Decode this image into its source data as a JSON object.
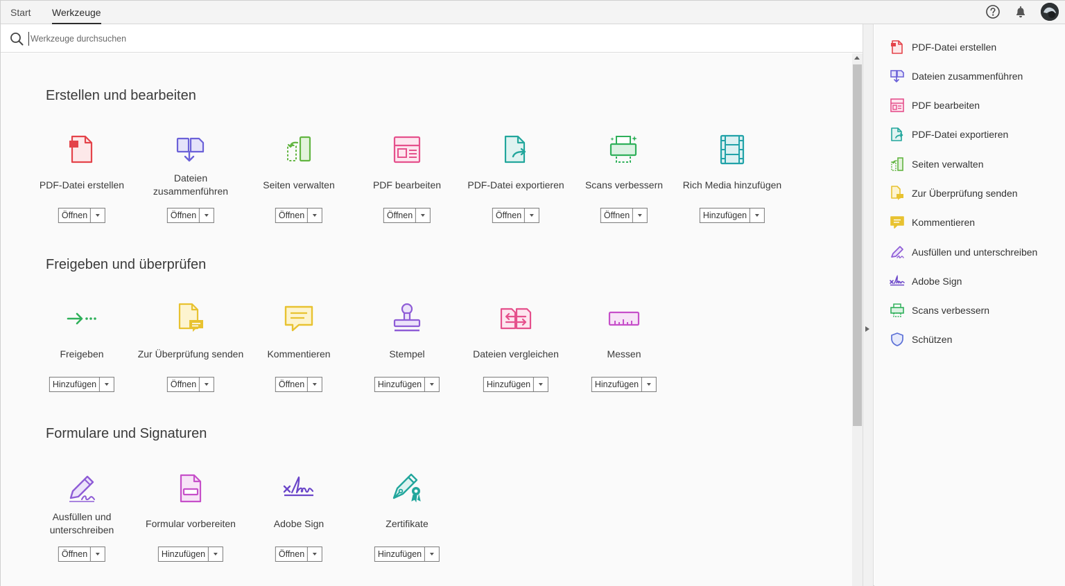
{
  "tabs": {
    "start": "Start",
    "tools": "Werkzeuge"
  },
  "search": {
    "placeholder": "Werkzeuge durchsuchen",
    "value": ""
  },
  "sections": [
    {
      "title": "Erstellen und bearbeiten",
      "tools": [
        {
          "label": "PDF-Datei erstellen",
          "button": "Öffnen",
          "icon": "create-pdf-icon",
          "color": "#e4434a"
        },
        {
          "label": "Dateien zusammenführen",
          "button": "Öffnen",
          "icon": "combine-files-icon",
          "color": "#6b61d8"
        },
        {
          "label": "Seiten verwalten",
          "button": "Öffnen",
          "icon": "organize-pages-icon",
          "color": "#62b541"
        },
        {
          "label": "PDF bearbeiten",
          "button": "Öffnen",
          "icon": "edit-pdf-icon",
          "color": "#e5508c"
        },
        {
          "label": "PDF-Datei exportieren",
          "button": "Öffnen",
          "icon": "export-pdf-icon",
          "color": "#22a69c"
        },
        {
          "label": "Scans verbessern",
          "button": "Öffnen",
          "icon": "enhance-scans-icon",
          "color": "#2fb05a"
        },
        {
          "label": "Rich Media hinzufügen",
          "button": "Hinzufügen",
          "icon": "rich-media-icon",
          "color": "#21a2a8"
        }
      ]
    },
    {
      "title": "Freigeben und überprüfen",
      "tools": [
        {
          "label": "Freigeben",
          "button": "Hinzufügen",
          "icon": "share-icon",
          "color": "#2fb05a"
        },
        {
          "label": "Zur Überprüfung senden",
          "button": "Öffnen",
          "icon": "send-review-icon",
          "color": "#e8c230"
        },
        {
          "label": "Kommentieren",
          "button": "Öffnen",
          "icon": "comment-icon",
          "color": "#e8c230"
        },
        {
          "label": "Stempel",
          "button": "Hinzufügen",
          "icon": "stamp-icon",
          "color": "#8e5cd6"
        },
        {
          "label": "Dateien vergleichen",
          "button": "Hinzufügen",
          "icon": "compare-files-icon",
          "color": "#e5508c"
        },
        {
          "label": "Messen",
          "button": "Hinzufügen",
          "icon": "measure-icon",
          "color": "#c64fc9"
        }
      ]
    },
    {
      "title": "Formulare und Signaturen",
      "tools": [
        {
          "label": "Ausfüllen und unterschreiben",
          "button": "Öffnen",
          "icon": "fill-sign-icon",
          "color": "#8e5cd6"
        },
        {
          "label": "Formular vorbereiten",
          "button": "Hinzufügen",
          "icon": "prepare-form-icon",
          "color": "#c64fc9"
        },
        {
          "label": "Adobe Sign",
          "button": "Öffnen",
          "icon": "adobe-sign-icon",
          "color": "#6b46c9"
        },
        {
          "label": "Zertifikate",
          "button": "Hinzufügen",
          "icon": "certificates-icon",
          "color": "#22a69c"
        }
      ]
    }
  ],
  "panel": [
    {
      "label": "PDF-Datei erstellen",
      "icon": "create-pdf-icon",
      "color": "#e4434a"
    },
    {
      "label": "Dateien zusammenführen",
      "icon": "combine-files-icon",
      "color": "#6b61d8"
    },
    {
      "label": "PDF bearbeiten",
      "icon": "edit-pdf-icon",
      "color": "#e5508c"
    },
    {
      "label": "PDF-Datei exportieren",
      "icon": "export-pdf-icon",
      "color": "#22a69c"
    },
    {
      "label": "Seiten verwalten",
      "icon": "organize-pages-icon",
      "color": "#62b541"
    },
    {
      "label": "Zur Überprüfung senden",
      "icon": "send-review-icon",
      "color": "#e8c230"
    },
    {
      "label": "Kommentieren",
      "icon": "comment-icon",
      "color": "#e8c230"
    },
    {
      "label": "Ausfüllen und unterschreiben",
      "icon": "fill-sign-icon",
      "color": "#8e5cd6"
    },
    {
      "label": "Adobe Sign",
      "icon": "adobe-sign-icon",
      "color": "#6b46c9"
    },
    {
      "label": "Scans verbessern",
      "icon": "enhance-scans-icon",
      "color": "#2fb05a"
    },
    {
      "label": "Schützen",
      "icon": "protect-icon",
      "color": "#5a6fd6"
    }
  ]
}
